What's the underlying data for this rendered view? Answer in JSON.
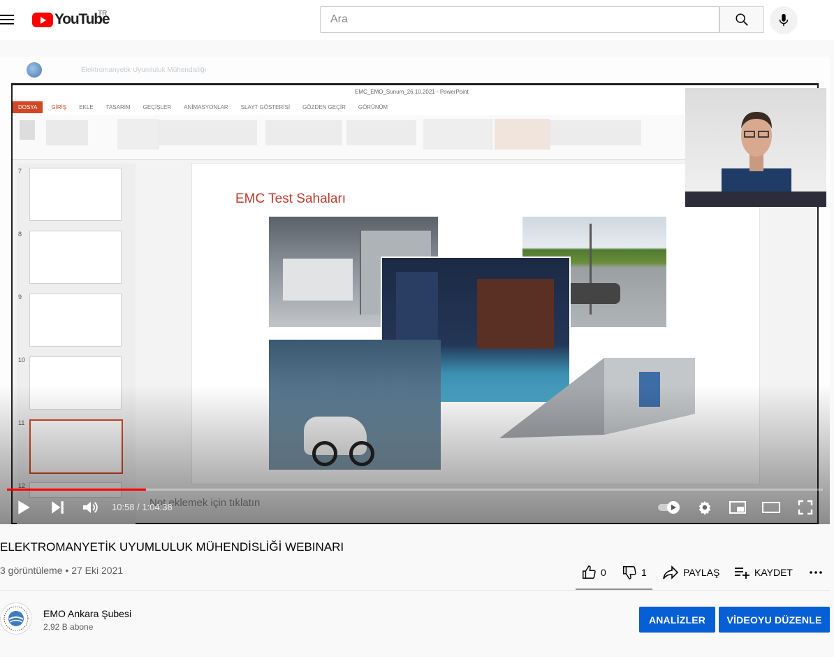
{
  "header": {
    "logo_text": "YouTube",
    "country_code": "TR",
    "search_placeholder": "Ara"
  },
  "icons": [
    "menu-icon",
    "youtube-logo-icon",
    "search-icon",
    "mic-icon",
    "play-icon",
    "next-icon",
    "volume-icon",
    "autoplay-toggle-icon",
    "settings-icon",
    "miniplayer-icon",
    "theater-icon",
    "fullscreen-icon",
    "like-icon",
    "dislike-icon",
    "share-icon",
    "save-icon",
    "more-icon"
  ],
  "video": {
    "time_display": "10:58 / 1:04:38",
    "progress_fraction": 0.17,
    "overlay": {
      "org_title": "Elektromanyetik Uyumluluk Mühendisliği",
      "ppt_window_title": "EMC_EMO_Sunum_26.10.2021 - PowerPoint",
      "ribbon_tabs": [
        "DOSYA",
        "GİRİŞ",
        "EKLE",
        "TASARIM",
        "GEÇİŞLER",
        "ANİMASYONLAR",
        "SLAYT GÖSTERİSİ",
        "GÖZDEN GEÇİR",
        "GÖRÜNÜM"
      ],
      "slide_numbers": [
        "7",
        "8",
        "9",
        "10",
        "11",
        "12"
      ],
      "slide_title": "EMC Test Sahaları",
      "notes_placeholder": "Not eklemek için tıklatın"
    }
  },
  "info": {
    "title": "ELEKTROMANYETİK UYUMLULUK MÜHENDİSLİĞİ WEBINARI",
    "views": "3 görüntüleme",
    "separator": "•",
    "date": "27 Eki 2021",
    "likes": "0",
    "dislikes": "1",
    "share_label": "PAYLAŞ",
    "save_label": "KAYDET"
  },
  "channel": {
    "name": "EMO Ankara Şubesi",
    "subscribers": "2,92 B abone",
    "analytics_button": "ANALİZLER",
    "edit_button": "VİDEOYU DÜZENLE"
  },
  "colors": {
    "accent": "#ff0000",
    "button_blue": "#065fd4",
    "slide_title_red": "#c0392b",
    "ppt_orange": "#d24726"
  }
}
